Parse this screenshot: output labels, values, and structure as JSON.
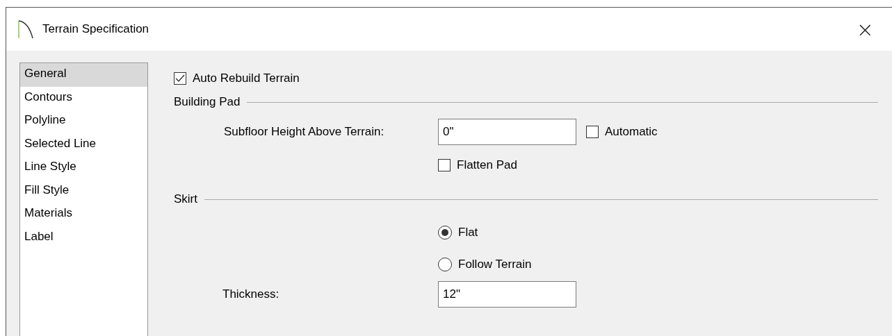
{
  "window": {
    "title": "Terrain Specification",
    "close": "×"
  },
  "sidebar": {
    "items": [
      {
        "label": "General",
        "selected": true
      },
      {
        "label": "Contours",
        "selected": false
      },
      {
        "label": "Polyline",
        "selected": false
      },
      {
        "label": "Selected Line",
        "selected": false
      },
      {
        "label": "Line Style",
        "selected": false
      },
      {
        "label": "Fill Style",
        "selected": false
      },
      {
        "label": "Materials",
        "selected": false
      },
      {
        "label": "Label",
        "selected": false
      }
    ]
  },
  "auto_rebuild": {
    "label": "Auto Rebuild Terrain",
    "checked": true
  },
  "building_pad": {
    "title": "Building Pad",
    "subfloor_label": "Subfloor Height Above Terrain:",
    "subfloor_value": "0\"",
    "automatic": {
      "label": "Automatic",
      "checked": false
    },
    "flatten": {
      "label": "Flatten Pad",
      "checked": false
    }
  },
  "skirt": {
    "title": "Skirt",
    "options": [
      {
        "label": "Flat",
        "selected": true
      },
      {
        "label": "Follow Terrain",
        "selected": false
      }
    ],
    "thickness_label": "Thickness:",
    "thickness_value": "12\""
  }
}
